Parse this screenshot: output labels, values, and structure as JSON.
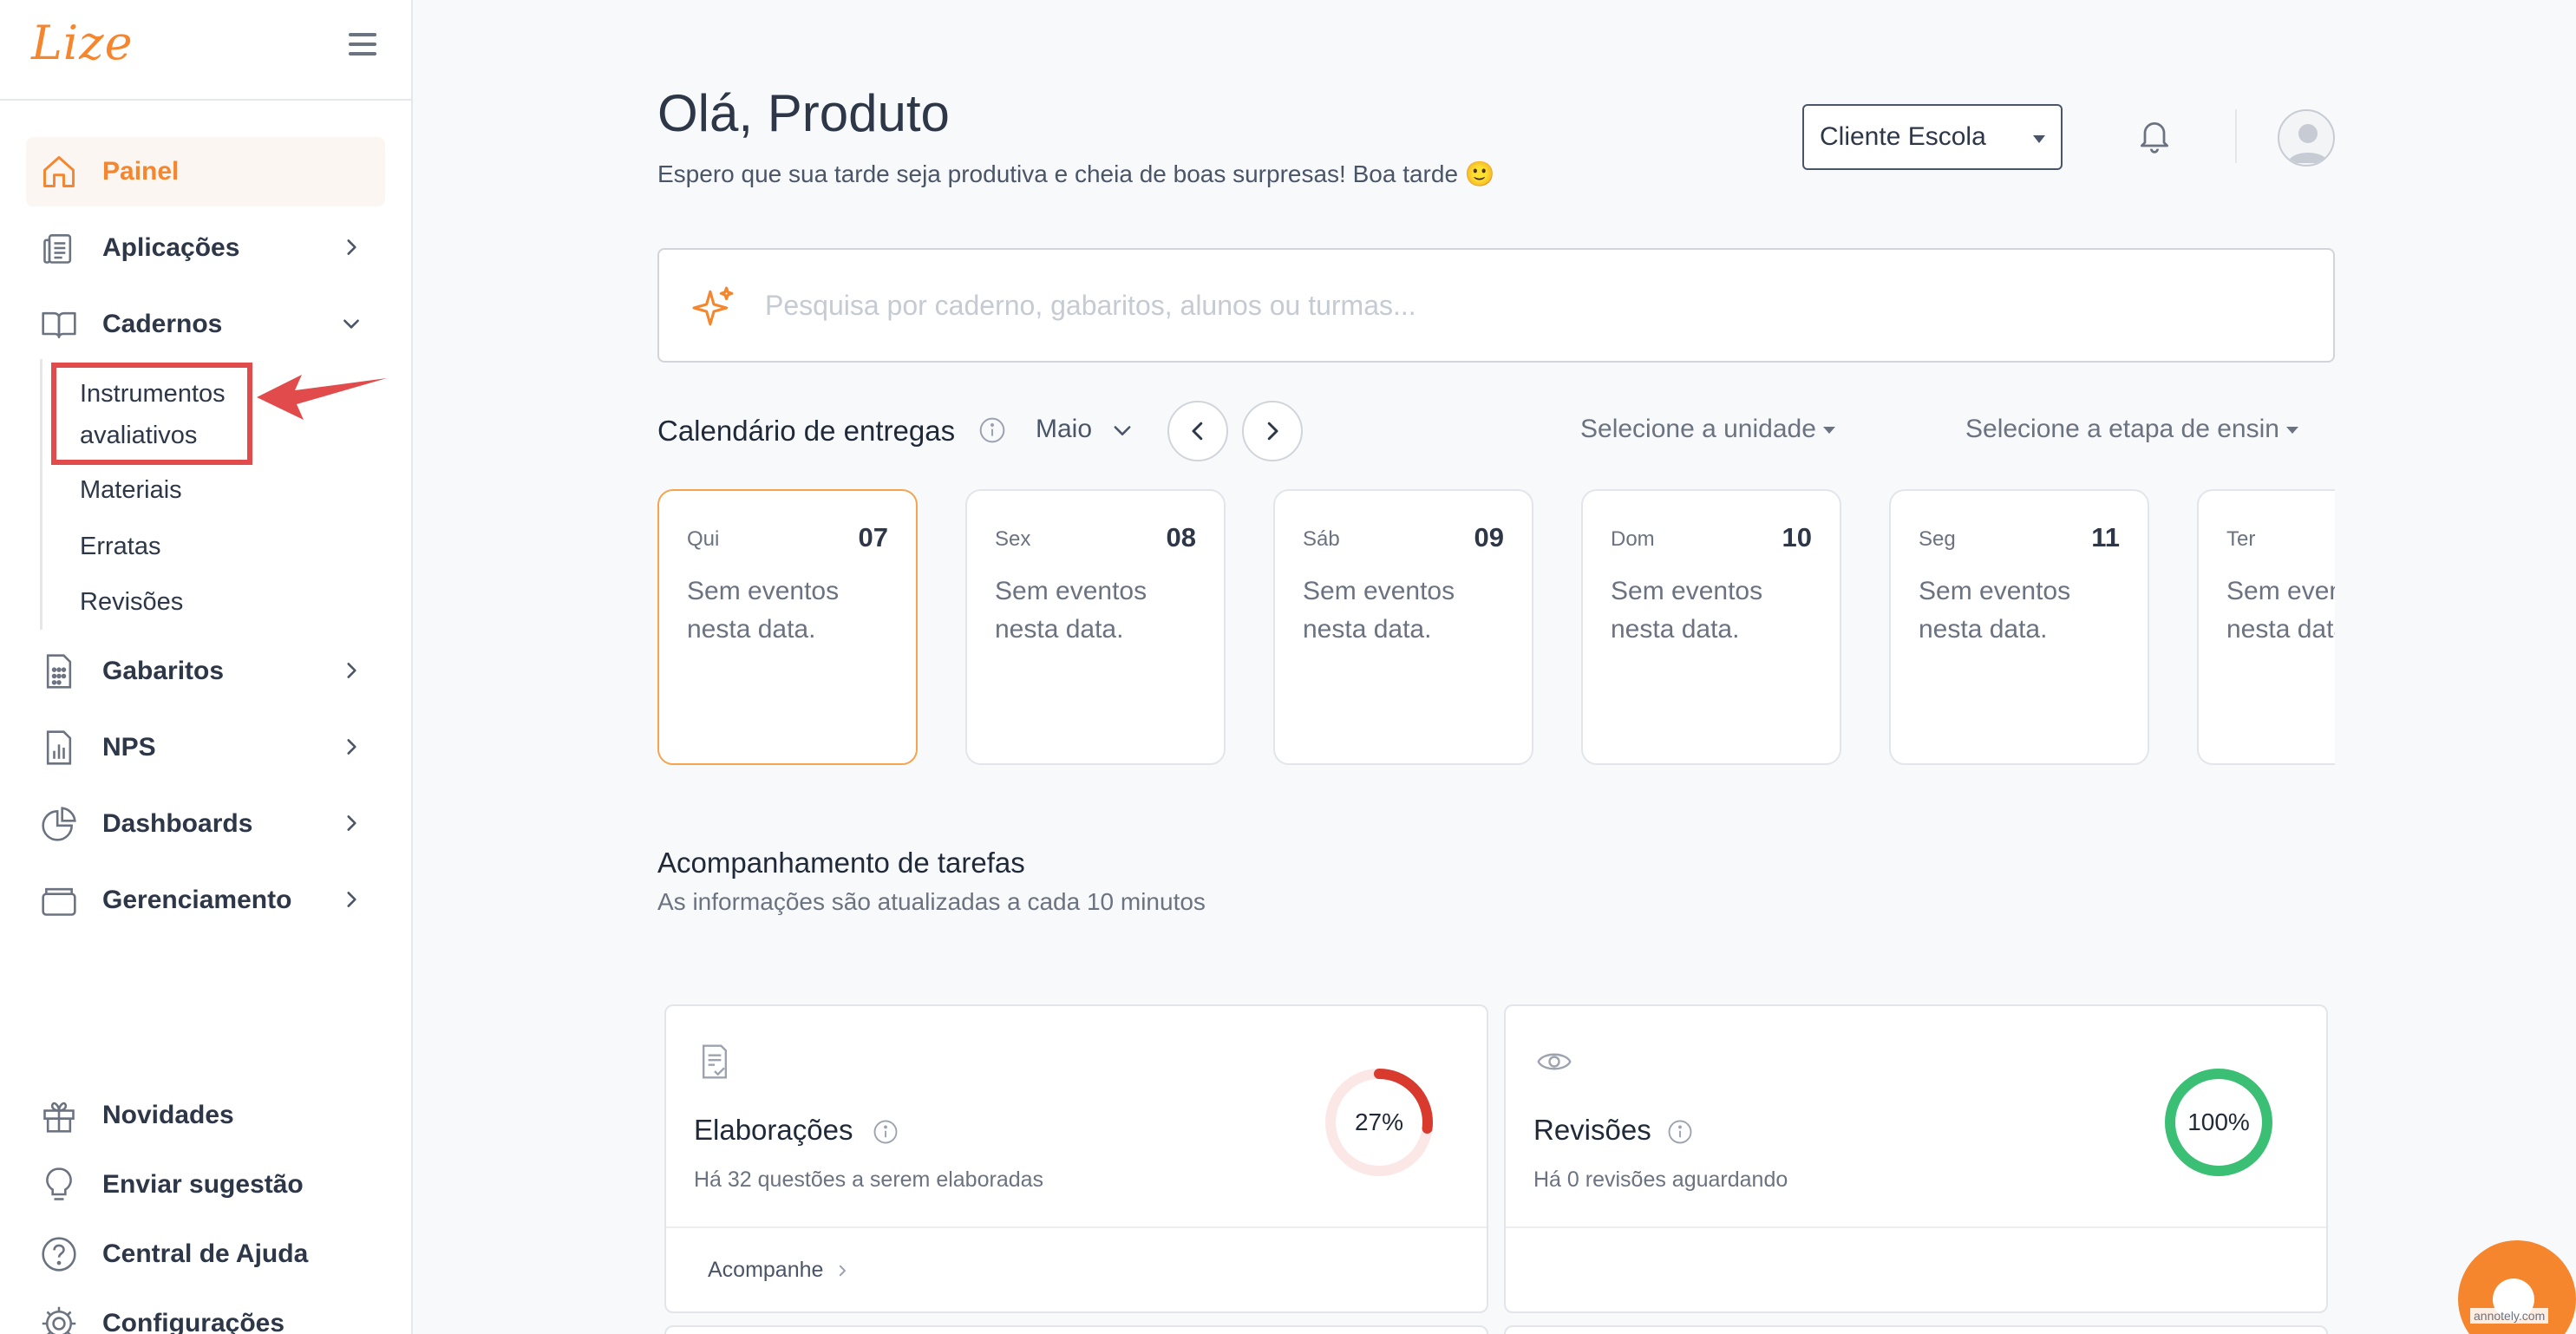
{
  "app": {
    "logo_text": "Lize",
    "brand_color": "#f5862e"
  },
  "sidebar": {
    "items": [
      {
        "label": "Painel",
        "icon": "home-icon",
        "active": true
      },
      {
        "label": "Aplicações",
        "icon": "clipboard-icon"
      },
      {
        "label": "Cadernos",
        "icon": "book-icon",
        "expanded": true
      },
      {
        "label": "Gabaritos",
        "icon": "answer-sheet-icon"
      },
      {
        "label": "NPS",
        "icon": "chart-file-icon"
      },
      {
        "label": "Dashboards",
        "icon": "pie-chart-icon"
      },
      {
        "label": "Gerenciamento",
        "icon": "folder-icon"
      }
    ],
    "subitems": [
      {
        "label_line1": "Instrumentos",
        "label_line2": "avaliativos"
      },
      {
        "label": "Materiais"
      },
      {
        "label": "Erratas"
      },
      {
        "label": "Revisões"
      }
    ],
    "footer": [
      {
        "label": "Novidades",
        "icon": "gift-icon"
      },
      {
        "label": "Enviar sugestão",
        "icon": "lightbulb-icon"
      },
      {
        "label": "Central de Ajuda",
        "icon": "help-circle-icon"
      },
      {
        "label": "Configurações",
        "icon": "gear-icon"
      }
    ]
  },
  "header": {
    "greeting": "Olá, Produto",
    "subtitle": "Espero que sua tarde seja produtiva e cheia de boas surpresas! Boa tarde 🙂",
    "client_select": "Cliente Escola"
  },
  "search": {
    "placeholder": "Pesquisa por caderno, gabaritos, alunos ou turmas..."
  },
  "calendar": {
    "title": "Calendário de entregas",
    "month": "Maio",
    "filter_unit": "Selecione a unidade",
    "filter_stage": "Selecione a etapa de ensin",
    "days": [
      {
        "name": "Qui",
        "num": "07",
        "msg1": "Sem eventos",
        "msg2": "nesta data."
      },
      {
        "name": "Sex",
        "num": "08",
        "msg1": "Sem eventos",
        "msg2": "nesta data."
      },
      {
        "name": "Sáb",
        "num": "09",
        "msg1": "Sem eventos",
        "msg2": "nesta data."
      },
      {
        "name": "Dom",
        "num": "10",
        "msg1": "Sem eventos",
        "msg2": "nesta data."
      },
      {
        "name": "Seg",
        "num": "11",
        "msg1": "Sem eventos",
        "msg2": "nesta data."
      },
      {
        "name": "Ter",
        "num": "",
        "msg1": "Sem eventos",
        "msg2": "nesta data."
      }
    ]
  },
  "tasks": {
    "title": "Acompanhamento de tarefas",
    "subtitle": "As informações são atualizadas a cada 10 minutos",
    "cards": [
      {
        "title": "Elaborações",
        "subtitle": "Há 32 questões a serem elaboradas",
        "percent": "27%",
        "progress": 0.27,
        "link": "Acompanhe",
        "color": "#d93a2e",
        "track": "#fbe7e6",
        "icon": "document-check-icon"
      },
      {
        "title": "Revisões",
        "subtitle": "Há 0 revisões aguardando",
        "percent": "100%",
        "progress": 1.0,
        "link": "",
        "color": "#3bbf74",
        "track": "#e4f6ec",
        "icon": "eye-icon"
      }
    ]
  },
  "watermark": "annotely.com"
}
